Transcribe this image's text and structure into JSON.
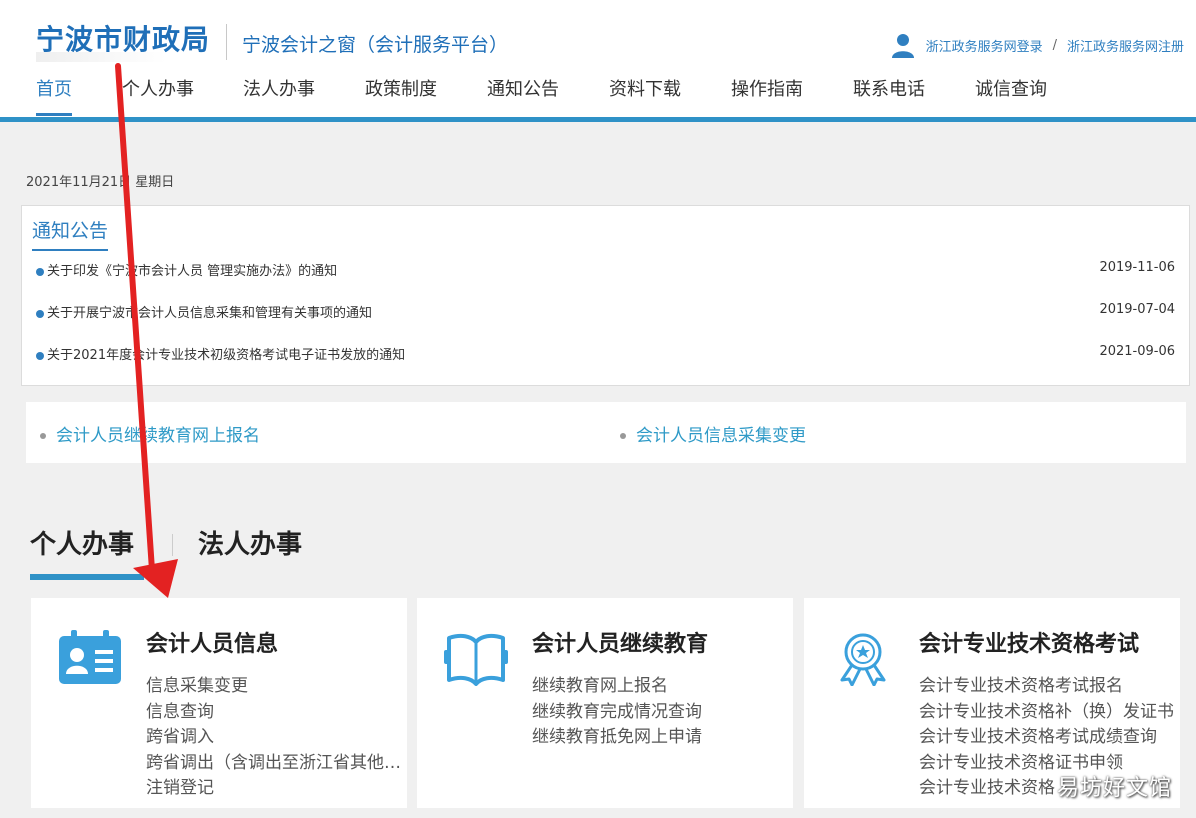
{
  "header": {
    "logo": "宁波市财政局",
    "site_title": "宁波会计之窗（会计服务平台）",
    "login_link": "浙江政务服务网登录",
    "separator": "/",
    "register_link": "浙江政务服务网注册"
  },
  "nav": {
    "items": [
      {
        "label": "首页",
        "active": true
      },
      {
        "label": "个人办事"
      },
      {
        "label": "法人办事"
      },
      {
        "label": "政策制度"
      },
      {
        "label": "通知公告"
      },
      {
        "label": "资料下载"
      },
      {
        "label": "操作指南"
      },
      {
        "label": "联系电话"
      },
      {
        "label": "诚信查询"
      }
    ]
  },
  "date_text": "2021年11月21日  星期日",
  "notices": {
    "title": "通知公告",
    "items": [
      {
        "text": "关于印发《宁波市会计人员 管理实施办法》的通知",
        "date": "2019-11-06"
      },
      {
        "text": "关于开展宁波市会计人员信息采集和管理有关事项的通知",
        "date": "2019-07-04"
      },
      {
        "text": "关于2021年度会计专业技术初级资格考试电子证书发放的通知",
        "date": "2021-09-06"
      }
    ]
  },
  "quick_links": [
    "会计人员继续教育网上报名",
    "会计人员信息采集变更"
  ],
  "tabs": [
    {
      "label": "个人办事",
      "active": true
    },
    {
      "label": "法人办事"
    }
  ],
  "cards": [
    {
      "title": "会计人员信息",
      "icon": "id-card-icon",
      "links": [
        "信息采集变更",
        "信息查询",
        "跨省调入",
        "跨省调出（含调出至浙江省其他地区）",
        "注销登记"
      ]
    },
    {
      "title": "会计人员继续教育",
      "icon": "open-book-icon",
      "links": [
        "继续教育网上报名",
        "继续教育完成情况查询",
        "继续教育抵免网上申请"
      ]
    },
    {
      "title": "会计专业技术资格考试",
      "icon": "award-badge-icon",
      "links": [
        "会计专业技术资格考试报名",
        "会计专业技术资格补（换）发证书",
        "会计专业技术资格考试成绩查询",
        "会计专业技术资格证书申领",
        "会计专业技术资格"
      ]
    }
  ],
  "watermark": "易坊好文馆",
  "colors": {
    "primary": "#2f7fc0",
    "accent_bar": "#2f92c7",
    "arrow": "#e32222"
  }
}
